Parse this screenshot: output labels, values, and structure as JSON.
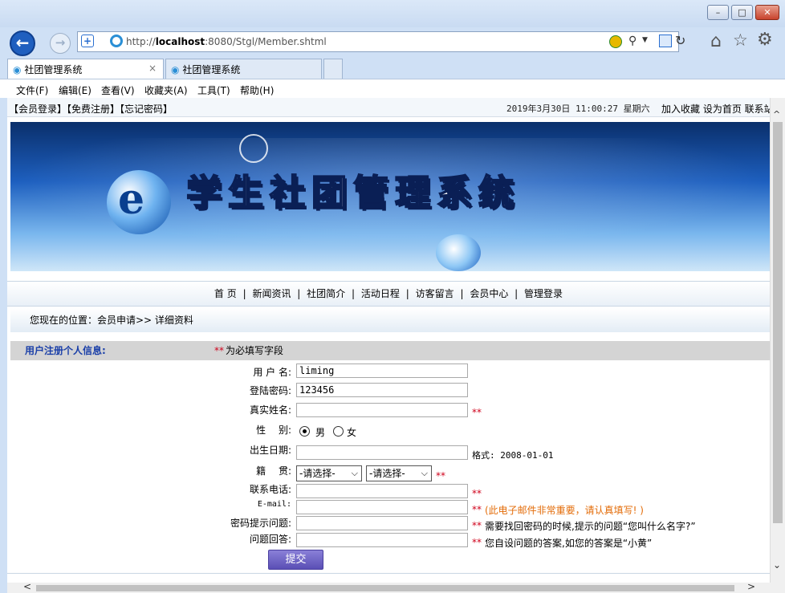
{
  "browser": {
    "url_prefix": "http://",
    "url_host": "localhost",
    "url_rest": ":8080/Stgl/Member.shtml",
    "tabs": [
      {
        "label": "社团管理系统",
        "close": "×"
      },
      {
        "label": "社团管理系统"
      }
    ],
    "menu": [
      "文件(F)",
      "编辑(E)",
      "查看(V)",
      "收藏夹(A)",
      "工具(T)",
      "帮助(H)"
    ],
    "window_controls": {
      "minimize": "–",
      "maximize": "□",
      "close": "✕"
    }
  },
  "page": {
    "top_links": "【会员登录】【免费注册】【忘记密码】",
    "datetime": "2019年3月30日 11:00:27  星期六",
    "top_right": "加入收藏 设为首页 联系站",
    "banner_title": "学生社团管理系统",
    "nav": [
      "首 页",
      "新闻资讯",
      "社团简介",
      "活动日程",
      "访客留言",
      "会员中心",
      "管理登录"
    ],
    "nav_sep": "|",
    "location": "您现在的位置：会员申请>> 详细资料",
    "reg_title": "用户注册个人信息:",
    "required_stars": "**",
    "required_note": "为必填写字段",
    "form": {
      "username_label": "用 户 名:",
      "username_value": "liming",
      "password_label": "登陆密码:",
      "password_value": "123456",
      "realname_label": "真实姓名:",
      "gender_label": "性　 别:",
      "gender_male": "男",
      "gender_female": "女",
      "birth_label": "出生日期:",
      "birth_hint": "格式: 2008-01-01",
      "origin_label": "籍　 贯:",
      "origin_select1": "-请选择-",
      "origin_select2": "-请选择-",
      "phone_label": "联系电话:",
      "email_label": "E-mail:",
      "email_hint": "(此电子邮件非常重要，请认真填写! )",
      "question_label": "密码提示问题:",
      "question_hint": "需要找回密码的时候,提示的问题“您叫什么名字?”",
      "answer_label": "问题回答:",
      "answer_hint": "您自设问题的答案,如您的答案是“小黄”",
      "submit_label": "提交"
    }
  },
  "colors": {
    "accent_blue": "#1a3fa8",
    "required_red": "#d0021b",
    "email_hint_orange": "#e36c09",
    "submit_purple": "#6b5fc4"
  }
}
